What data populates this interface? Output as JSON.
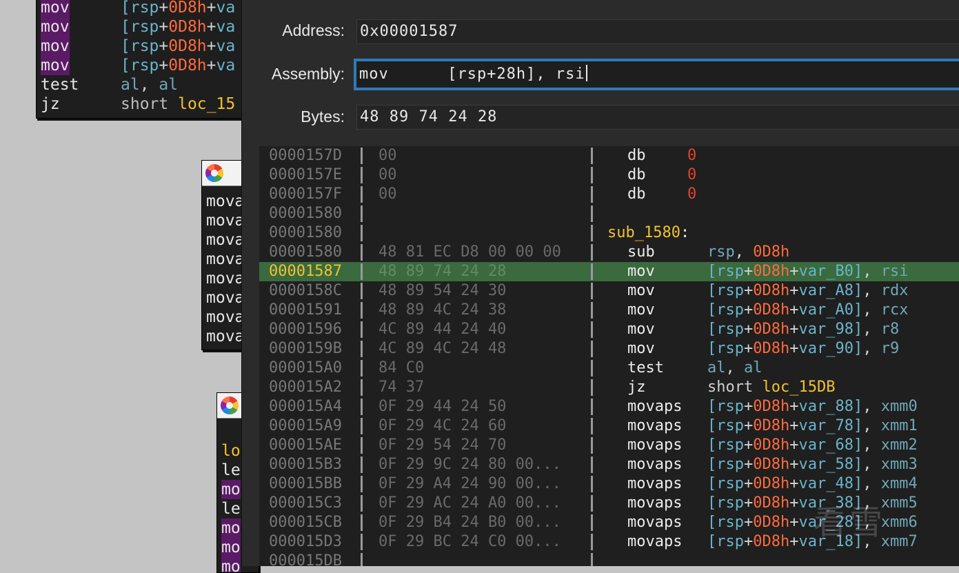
{
  "background_blocks": {
    "block1": {
      "lines": [
        {
          "mnem": "mov",
          "highlight": true,
          "ops": [
            [
              "b",
              "["
            ],
            [
              "b",
              "rsp"
            ],
            [
              "p",
              "+"
            ],
            [
              "o",
              "0D8h"
            ],
            [
              "p",
              "+"
            ],
            [
              "b",
              "va"
            ]
          ]
        },
        {
          "mnem": "mov",
          "highlight": true,
          "ops": [
            [
              "b",
              "["
            ],
            [
              "b",
              "rsp"
            ],
            [
              "p",
              "+"
            ],
            [
              "o",
              "0D8h"
            ],
            [
              "p",
              "+"
            ],
            [
              "b",
              "va"
            ]
          ]
        },
        {
          "mnem": "mov",
          "highlight": true,
          "ops": [
            [
              "b",
              "["
            ],
            [
              "b",
              "rsp"
            ],
            [
              "p",
              "+"
            ],
            [
              "o",
              "0D8h"
            ],
            [
              "p",
              "+"
            ],
            [
              "b",
              "va"
            ]
          ]
        },
        {
          "mnem": "mov",
          "highlight": true,
          "ops": [
            [
              "b",
              "["
            ],
            [
              "b",
              "rsp"
            ],
            [
              "p",
              "+"
            ],
            [
              "o",
              "0D8h"
            ],
            [
              "p",
              "+"
            ],
            [
              "b",
              "va"
            ]
          ]
        },
        {
          "mnem": "test",
          "highlight": false,
          "ops": [
            [
              "g",
              "al"
            ],
            [
              "p",
              ", "
            ],
            [
              "g",
              "al"
            ]
          ]
        },
        {
          "mnem": "jz",
          "highlight": false,
          "ops": [
            [
              "s",
              "short "
            ],
            [
              "y",
              "loc_15"
            ]
          ]
        }
      ]
    },
    "block2": {
      "lines": [
        "mova",
        "mova",
        "mova",
        "mova",
        "mova",
        "mova",
        "mova",
        "mova"
      ]
    },
    "block3": {
      "lines": [
        {
          "text": "lo",
          "kind": "label"
        },
        {
          "text": "le",
          "kind": "plain"
        },
        {
          "text": "mo",
          "kind": "highlight"
        },
        {
          "text": "le",
          "kind": "plain"
        },
        {
          "text": "mo",
          "kind": "highlight"
        },
        {
          "text": "mo",
          "kind": "highlight"
        },
        {
          "text": "mo",
          "kind": "highlight"
        }
      ]
    }
  },
  "dialog": {
    "address_label": "Address:",
    "address_value": "0x00001587",
    "assembly_label": "Assembly:",
    "assembly_value": "mov      [rsp+28h], rsi",
    "bytes_label": "Bytes:",
    "bytes_value": "48 89 74 24 28"
  },
  "listing": [
    {
      "addr": "0000157D",
      "hex": "00",
      "kind": "db",
      "mnem": "db",
      "num": "0"
    },
    {
      "addr": "0000157E",
      "hex": "00",
      "kind": "db",
      "mnem": "db",
      "num": "0"
    },
    {
      "addr": "0000157F",
      "hex": "00",
      "kind": "db",
      "mnem": "db",
      "num": "0"
    },
    {
      "addr": "00001580",
      "hex": "",
      "kind": "empty"
    },
    {
      "addr": "00001580",
      "hex": "",
      "kind": "label",
      "label": "sub_1580"
    },
    {
      "addr": "00001580",
      "hex": "48 81 EC D8 00 00 00",
      "kind": "regimm",
      "mnem": "sub",
      "reg": "rsp",
      "imm": "0D8h"
    },
    {
      "addr": "00001587",
      "hex": "48 89 74 24 28",
      "kind": "mem",
      "mnem": "mov",
      "var": "var_B0",
      "reg": "rsi",
      "current": true
    },
    {
      "addr": "0000158C",
      "hex": "48 89 54 24 30",
      "kind": "mem",
      "mnem": "mov",
      "var": "var_A8",
      "reg": "rdx"
    },
    {
      "addr": "00001591",
      "hex": "48 89 4C 24 38",
      "kind": "mem",
      "mnem": "mov",
      "var": "var_A0",
      "reg": "rcx"
    },
    {
      "addr": "00001596",
      "hex": "4C 89 44 24 40",
      "kind": "mem",
      "mnem": "mov",
      "var": "var_98",
      "reg": "r8"
    },
    {
      "addr": "0000159B",
      "hex": "4C 89 4C 24 48",
      "kind": "mem",
      "mnem": "mov",
      "var": "var_90",
      "reg": "r9"
    },
    {
      "addr": "000015A0",
      "hex": "84 C0",
      "kind": "regreg",
      "mnem": "test",
      "reg1": "al",
      "reg2": "al"
    },
    {
      "addr": "000015A2",
      "hex": "74 37",
      "kind": "jump",
      "mnem": "jz",
      "short": "short",
      "target": "loc_15DB"
    },
    {
      "addr": "000015A4",
      "hex": "0F 29 44 24 50",
      "kind": "mem",
      "mnem": "movaps",
      "var": "var_88",
      "reg": "xmm0"
    },
    {
      "addr": "000015A9",
      "hex": "0F 29 4C 24 60",
      "kind": "mem",
      "mnem": "movaps",
      "var": "var_78",
      "reg": "xmm1"
    },
    {
      "addr": "000015AE",
      "hex": "0F 29 54 24 70",
      "kind": "mem",
      "mnem": "movaps",
      "var": "var_68",
      "reg": "xmm2"
    },
    {
      "addr": "000015B3",
      "hex": "0F 29 9C 24 80 00...",
      "kind": "mem",
      "mnem": "movaps",
      "var": "var_58",
      "reg": "xmm3"
    },
    {
      "addr": "000015BB",
      "hex": "0F 29 A4 24 90 00...",
      "kind": "mem",
      "mnem": "movaps",
      "var": "var_48",
      "reg": "xmm4"
    },
    {
      "addr": "000015C3",
      "hex": "0F 29 AC 24 A0 00...",
      "kind": "mem",
      "mnem": "movaps",
      "var": "var_38",
      "reg": "xmm5"
    },
    {
      "addr": "000015CB",
      "hex": "0F 29 B4 24 B0 00...",
      "kind": "mem",
      "mnem": "movaps",
      "var": "var_28",
      "reg": "xmm6"
    },
    {
      "addr": "000015D3",
      "hex": "0F 29 BC 24 C0 00...",
      "kind": "mem",
      "mnem": "movaps",
      "var": "var_18",
      "reg": "xmm7"
    },
    {
      "addr": "000015DB",
      "hex": "",
      "kind": "empty"
    }
  ],
  "tokens": {
    "rsp": "rsp",
    "base_off": "0D8h"
  },
  "watermark": "看雪",
  "colors": {
    "dialog_bg": "#2b2b2b",
    "focus_ring": "#2f7ab8",
    "current_line": "#3a6a3e",
    "label_yellow": "#f2c230",
    "imm_orange": "#ff6a3d",
    "var_blue": "#6bb4cc",
    "reg_teal": "#6fa8b8",
    "highlight_purple": "#5b1a66"
  }
}
